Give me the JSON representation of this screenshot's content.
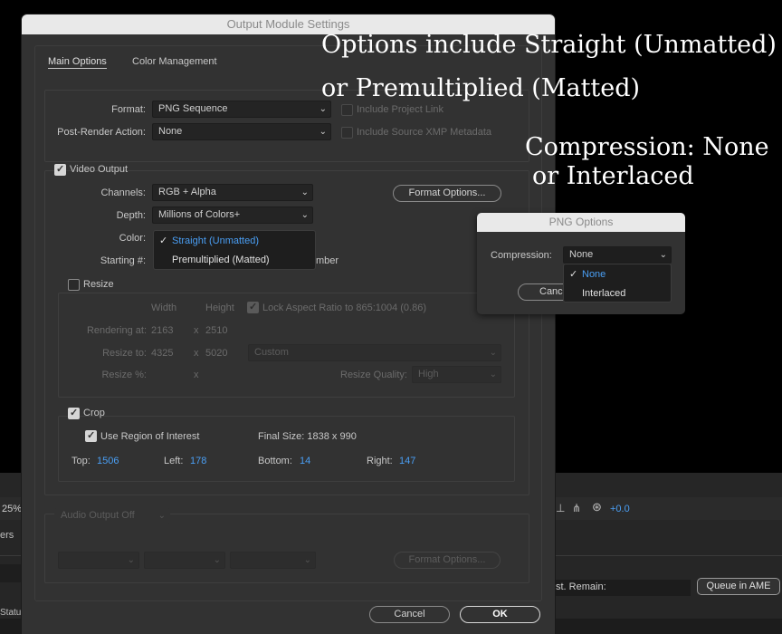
{
  "background": {
    "zoom": "25%",
    "left_text": "ers",
    "status": "Status",
    "offset": "+0.0",
    "est_remain": "st. Remain:",
    "queue_button": "Queue in AME"
  },
  "dialog": {
    "title": "Output Module Settings",
    "tabs": [
      "Main Options",
      "Color Management"
    ],
    "format": {
      "label": "Format:",
      "value": "PNG Sequence"
    },
    "post_render": {
      "label": "Post-Render Action:",
      "value": "None"
    },
    "include_project_link": "Include Project Link",
    "include_xmp": "Include Source XMP Metadata",
    "video_output": "Video Output",
    "channels": {
      "label": "Channels:",
      "value": "RGB + Alpha"
    },
    "depth": {
      "label": "Depth:",
      "value": "Millions of Colors+"
    },
    "color_label": "Color:",
    "color_options": [
      "Straight (Unmatted)",
      "Premultiplied (Matted)"
    ],
    "starting_label": "Starting #:",
    "starting_tail": "mber",
    "format_options": "Format Options...",
    "resize": {
      "label": "Resize",
      "width_hdr": "Width",
      "height_hdr": "Height",
      "lock_aspect": "Lock Aspect Ratio to 865:1004 (0.86)",
      "rendering_at": "Rendering at:",
      "rendering_w": "2163",
      "rendering_h": "2510",
      "resize_to": "Resize to:",
      "resize_w": "4325",
      "resize_h": "5020",
      "preset": "Custom",
      "resize_pct": "Resize %:",
      "x": "x",
      "quality_label": "Resize Quality:",
      "quality": "High"
    },
    "crop": {
      "label": "Crop",
      "use_roi": "Use Region of Interest",
      "final_size": "Final Size: 1838 x 990",
      "top_label": "Top:",
      "top": "1506",
      "left_label": "Left:",
      "left": "178",
      "bottom_label": "Bottom:",
      "bottom": "14",
      "right_label": "Right:",
      "right": "147"
    },
    "audio": {
      "output": "Audio Output Off",
      "format_options": "Format Options..."
    },
    "cancel": "Cancel",
    "ok": "OK"
  },
  "png_options": {
    "title": "PNG Options",
    "compression_label": "Compression:",
    "compression": "None",
    "compression_options": [
      "None",
      "Interlaced"
    ],
    "cancel_partial": "Cance"
  },
  "annotations": {
    "line1": "Options include Straight (Unmatted)",
    "line2": "or Premultiplied (Matted)",
    "line3": "Compression: None",
    "line4": "or Interlaced"
  }
}
